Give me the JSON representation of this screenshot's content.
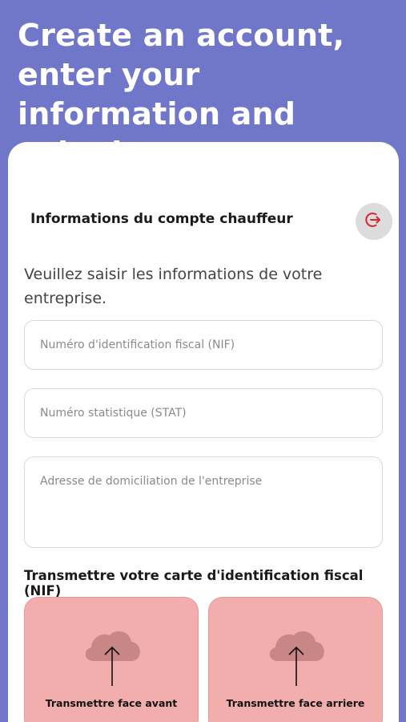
{
  "header": {
    "headline": "Create an account, enter your information and submit your documents"
  },
  "card": {
    "section_title": "Informations du compte chauffeur",
    "logout_icon": "logout-icon",
    "instructions": "Veuillez saisir les informations de votre entreprise.",
    "fields": {
      "nif_placeholder": "Numéro d'identification fiscal (NIF)",
      "stat_placeholder": "Numéro statistique (STAT)",
      "address_placeholder": "Adresse de domiciliation de l'entreprise"
    },
    "upload": {
      "title": "Transmettre votre carte d'identification fiscal (NIF)",
      "front_label": "Transmettre face avant",
      "back_label": "Transmettre face arriere",
      "icon": "cloud-upload-icon"
    }
  },
  "colors": {
    "background": "#7077c8",
    "card": "#ffffff",
    "upload_tile": "#f2adad",
    "logout_accent": "#e0242c"
  }
}
